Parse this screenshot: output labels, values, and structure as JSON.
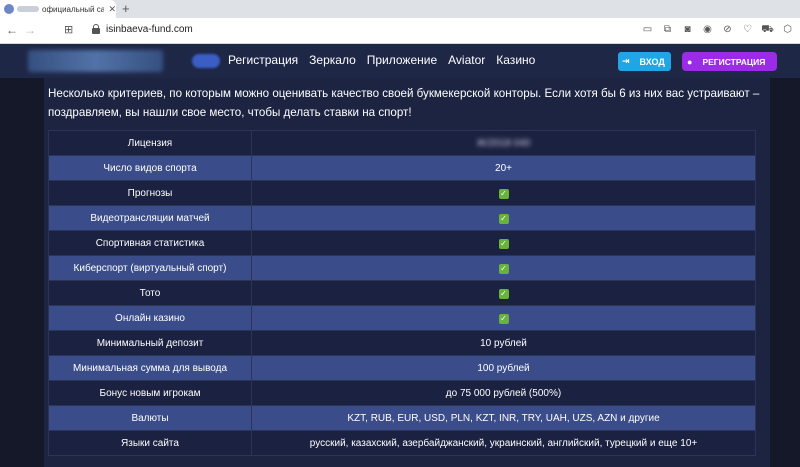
{
  "browser": {
    "tab_title": "официальный сайт букм",
    "url": "isinbaeva-fund.com"
  },
  "header": {
    "nav": [
      "Регистрация",
      "Зеркало",
      "Приложение",
      "Aviator",
      "Казино"
    ],
    "login_label": "ВХОД",
    "register_label": "РЕГИСТРАЦИЯ"
  },
  "intro": "Несколько критериев, по которым можно оценивать качество своей букмекерской конторы. Если хотя бы 6 из них вас устраивают – поздравляем, вы нашли свое место, чтобы делать ставки на спорт!",
  "table": {
    "rows": [
      {
        "label": "Лицензия",
        "value": "Ж/2018 040"
      },
      {
        "label": "Число видов спорта",
        "value": "20+"
      },
      {
        "label": "Прогнозы",
        "value": "✓"
      },
      {
        "label": "Видеотрансляции матчей",
        "value": "✓"
      },
      {
        "label": "Спортивная статистика",
        "value": "✓"
      },
      {
        "label": "Киберспорт (виртуальный спорт)",
        "value": "✓"
      },
      {
        "label": "Тото",
        "value": "✓"
      },
      {
        "label": "Онлайн казино",
        "value": "✓"
      },
      {
        "label": "Минимальный депозит",
        "value": "10 рублей"
      },
      {
        "label": "Минимальная сумма для вывода",
        "value": "100 рублей"
      },
      {
        "label": "Бонус новым игрокам",
        "value": "до 75 000 рублей (500%)"
      },
      {
        "label": "Валюты",
        "value": "KZT, RUB, EUR, USD, PLN, KZT, INR, TRY, UAH, UZS, AZN и другие"
      },
      {
        "label": "Языки сайта",
        "value": "русский, казахский, азербайджанский, украинский, английский, турецкий и еще 10+"
      }
    ]
  },
  "colors": {
    "login_button": "#20a6e6",
    "register_button": "#9b2be6",
    "check_icon": "#69b33a"
  }
}
